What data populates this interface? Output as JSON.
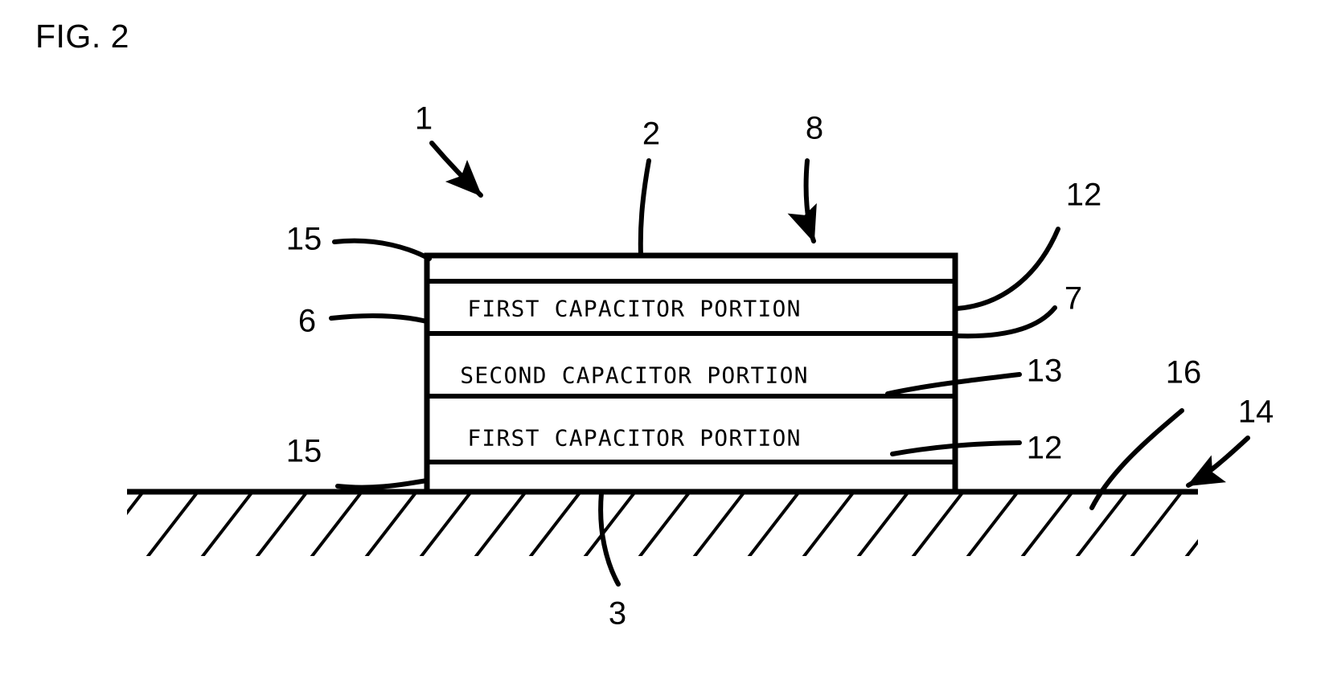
{
  "figure": {
    "title": "FIG. 2",
    "stroke_color": "#000000",
    "background_color": "#ffffff"
  },
  "device_stack": {
    "layers": [
      {
        "id": "layer-top-thin",
        "label": ""
      },
      {
        "id": "layer-first-upper",
        "label": "FIRST CAPACITOR PORTION"
      },
      {
        "id": "layer-second-mid",
        "label": "SECOND CAPACITOR PORTION"
      },
      {
        "id": "layer-first-lower",
        "label": "FIRST CAPACITOR PORTION"
      },
      {
        "id": "layer-bottom-thin",
        "label": ""
      }
    ]
  },
  "reference_numerals": {
    "item_1": "1",
    "item_2": "2",
    "item_8": "8",
    "item_12_top": "12",
    "item_7": "7",
    "item_13": "13",
    "item_12_bottom": "12",
    "item_15_top": "15",
    "item_6": "6",
    "item_15_bottom": "15",
    "item_16": "16",
    "item_14": "14",
    "item_3": "3"
  },
  "substrate": {
    "name": "hatched-substrate",
    "hatch_angle_deg": 50
  }
}
